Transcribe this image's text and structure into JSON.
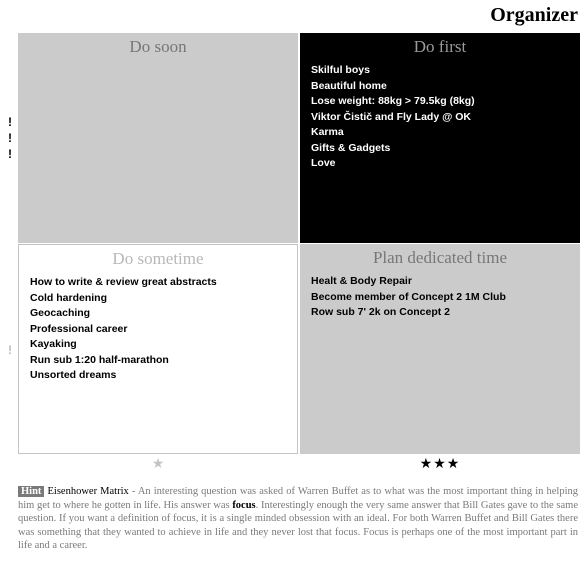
{
  "header": {
    "title": "Organizer"
  },
  "quadrants": {
    "do_soon": {
      "title": "Do soon",
      "items": []
    },
    "do_first": {
      "title": "Do first",
      "items": [
        "Skilful boys",
        "Beautiful home",
        "Lose weight: 88kg > 79.5kg (8kg)",
        "Viktor Čistič and Fly Lady @ OK",
        "Karma",
        "Gifts & Gadgets",
        "Love"
      ]
    },
    "do_sometime": {
      "title": "Do sometime",
      "items": [
        "How to write & review great abstracts",
        "Cold hardening",
        "Geocaching",
        "Professional career",
        "Kayaking",
        "Run sub 1:20 half-marathon",
        "Unsorted dreams"
      ]
    },
    "plan_dedicated_time": {
      "title": "Plan dedicated time",
      "items": [
        "Healt & Body Repair",
        "Become member of Concept 2 1M Club",
        "Row sub 7' 2k on Concept 2"
      ]
    }
  },
  "priority_markers": {
    "top": [
      "!",
      "!",
      "!"
    ],
    "bottom": [
      "!"
    ]
  },
  "importance": {
    "left": "★",
    "right": "★★★"
  },
  "hint": {
    "badge": "Hint",
    "topic": "Eisenhower Matrix",
    "text_before": " - An interesting question was asked of Warren Buffet as to what was the most important thing in helping him get to where he gotten in life. His answer was ",
    "focus_word": "focus",
    "text_after": ". Interestingly enough the very same answer that Bill Gates gave to the same question. If you want a definition of focus, it is a single minded obsession with an ideal. For both Warren Buffet and Bill Gates there was something that they wanted to achieve in life and they never lost that focus. Focus is perhaps one of the most important part in life and a career."
  }
}
